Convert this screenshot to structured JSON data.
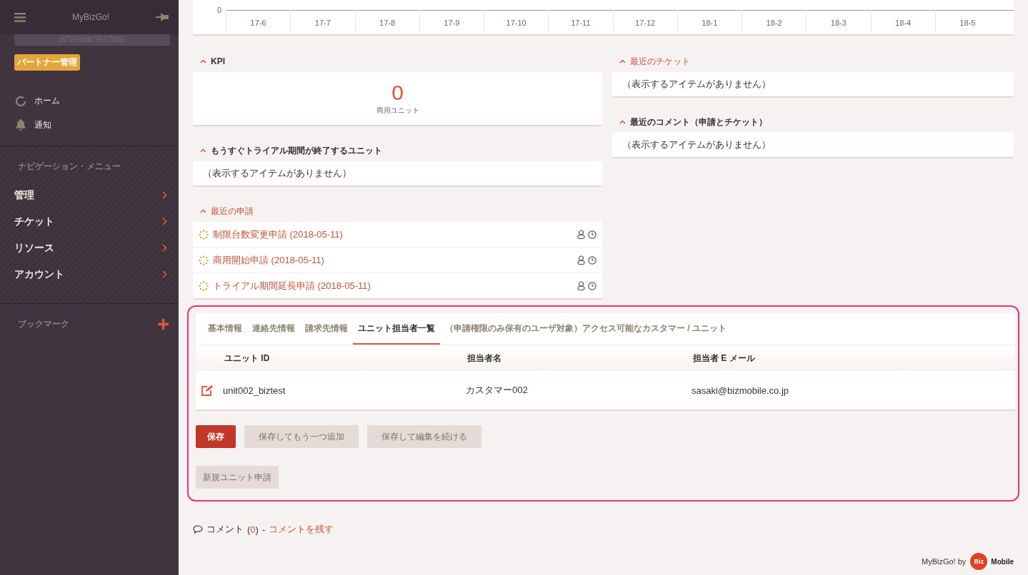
{
  "sidebar": {
    "title": "MyBizGo!",
    "tenant": "INTERNALTESTING",
    "role_badge": "パートナー管理",
    "quick_items": [
      {
        "label": "ホーム",
        "kind": "home"
      },
      {
        "label": "通知",
        "kind": "bell"
      }
    ],
    "nav_heading": "ナビゲーション・メニュー",
    "nav_items": [
      {
        "label": "管理"
      },
      {
        "label": "チケット"
      },
      {
        "label": "リソース"
      },
      {
        "label": "アカウント"
      }
    ],
    "bookmarks_heading": "ブックマーク"
  },
  "chart_strip": {
    "y_tick": "0",
    "x_labels": [
      "17-6",
      "17-7",
      "17-8",
      "17-9",
      "17-10",
      "17-11",
      "17-12",
      "18-1",
      "18-2",
      "18-3",
      "18-4",
      "18-5"
    ]
  },
  "kpi": {
    "title": "KPI",
    "value": "0",
    "label": "商用ユニット"
  },
  "trial_ending": {
    "title": "もうすぐトライアル期間が終了するユニット",
    "empty": "（表示するアイテムがありません）"
  },
  "recent_requests": {
    "title": "最近の申請",
    "items": [
      {
        "label": "制限台数変更申請 (2018-05-11)"
      },
      {
        "label": "商用開始申請 (2018-05-11)"
      },
      {
        "label": "トライアル期間延長申請 (2018-05-11)"
      }
    ]
  },
  "recent_tickets": {
    "title": "最近のチケット",
    "empty": "（表示するアイテムがありません）"
  },
  "recent_comments": {
    "title": "最近のコメント（申請とチケット）",
    "empty": "（表示するアイテムがありません）"
  },
  "tabs": [
    {
      "label": "基本情報",
      "selected": false
    },
    {
      "label": "連絡先情報",
      "selected": false
    },
    {
      "label": "請求先情報",
      "selected": false
    },
    {
      "label": "ユニット担当者一覧",
      "selected": true
    },
    {
      "label": "（申請権限のみ保有のユーザ対象）アクセス可能なカスタマー / ユニット",
      "selected": false
    }
  ],
  "table": {
    "columns": [
      "ユニット ID",
      "担当者名",
      "担当者 E メール"
    ],
    "rows": [
      [
        "unit002_biztest",
        "カスタマー002",
        "sasaki@bizmobile.co.jp"
      ]
    ]
  },
  "buttons": [
    {
      "label": "保存",
      "kind": "primary"
    },
    {
      "label": "保存してもう一つ追加",
      "kind": "secondary"
    },
    {
      "label": "保存して編集を続ける",
      "kind": "secondary"
    }
  ],
  "new_unit_button": "新規ユニット申請",
  "comments": {
    "label": "コメント",
    "count_open": "(",
    "count": "0",
    "count_close": ")",
    "separator": "-",
    "link": "コメントを残す"
  },
  "footer": {
    "text": "MyBizGo! by",
    "logo_left": "Biz",
    "logo_right": "Mobile"
  }
}
